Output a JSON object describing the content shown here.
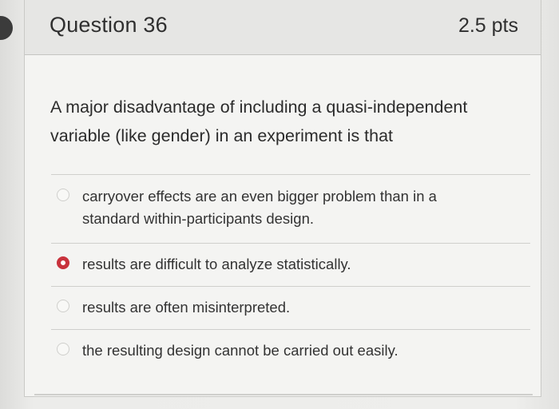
{
  "question": {
    "title": "Question 36",
    "points": "2.5 pts",
    "text": "A major disadvantage of including a quasi-independent variable (like gender) in an experiment is that"
  },
  "answers": [
    {
      "label": "carryover effects are an even bigger problem than in a standard within-participants design.",
      "selected": false
    },
    {
      "label": "results are difficult to analyze statistically.",
      "selected": true
    },
    {
      "label": "results are often misinterpreted.",
      "selected": false
    },
    {
      "label": "the resulting design cannot be carried out easily.",
      "selected": false
    }
  ],
  "colors": {
    "selected_radio": "#c8323c",
    "text": "#2b2b2b"
  }
}
